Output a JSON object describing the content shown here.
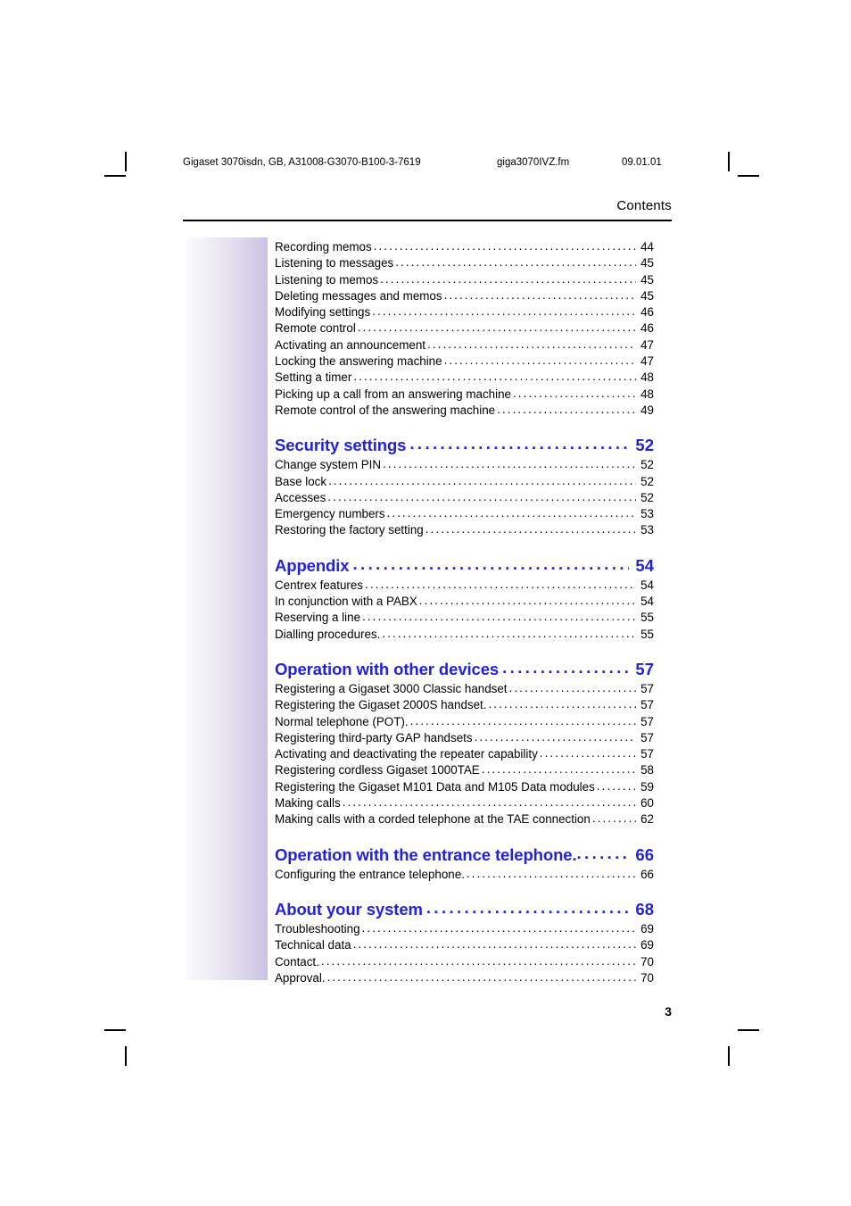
{
  "header": {
    "doc_id": "Gigaset 3070isdn, GB, A31008-G3070-B100-3-7619",
    "file_name": "giga3070IVZ.fm",
    "date": "09.01.01",
    "chapter_title": "Contents"
  },
  "folio": {
    "page_number": "3"
  },
  "toc": {
    "groups": [
      {
        "heading": null,
        "entries": [
          {
            "label": "Recording memos",
            "page": "44"
          },
          {
            "label": "Listening to messages",
            "page": "45"
          },
          {
            "label": "Listening to memos",
            "page": "45"
          },
          {
            "label": "Deleting messages and memos",
            "page": "45"
          },
          {
            "label": "Modifying settings",
            "page": "46"
          },
          {
            "label": "Remote control",
            "page": "46"
          },
          {
            "label": "Activating an announcement",
            "page": "47"
          },
          {
            "label": "Locking the answering machine",
            "page": "47"
          },
          {
            "label": "Setting a timer",
            "page": "48"
          },
          {
            "label": "Picking up a call from an answering machine",
            "page": "48"
          },
          {
            "label": "Remote control of the answering machine",
            "page": "49"
          }
        ]
      },
      {
        "heading": {
          "label": "Security settings",
          "page": "52"
        },
        "entries": [
          {
            "label": "Change system PIN",
            "page": "52"
          },
          {
            "label": "Base lock",
            "page": "52"
          },
          {
            "label": "Accesses",
            "page": "52"
          },
          {
            "label": "Emergency numbers",
            "page": "53"
          },
          {
            "label": "Restoring the factory setting",
            "page": "53"
          }
        ]
      },
      {
        "heading": {
          "label": "Appendix",
          "page": "54"
        },
        "entries": [
          {
            "label": "Centrex features",
            "page": "54"
          },
          {
            "label": "In conjunction with a PABX",
            "page": "54"
          },
          {
            "label": "Reserving a line",
            "page": "55"
          },
          {
            "label": "Dialling procedures.",
            "page": "55"
          }
        ]
      },
      {
        "heading": {
          "label": "Operation with other devices",
          "page": "57"
        },
        "entries": [
          {
            "label": "Registering a Gigaset 3000 Classic handset",
            "page": "57"
          },
          {
            "label": "Registering the Gigaset 2000S handset.",
            "page": "57"
          },
          {
            "label": "Normal telephone (POT).",
            "page": "57"
          },
          {
            "label": "Registering third-party GAP handsets",
            "page": "57"
          },
          {
            "label": "Activating and deactivating the repeater capability",
            "page": "57"
          },
          {
            "label": "Registering cordless Gigaset 1000TAE",
            "page": "58"
          },
          {
            "label": "Registering the Gigaset M101 Data and M105 Data modules",
            "page": "59"
          },
          {
            "label": "Making calls",
            "page": "60"
          },
          {
            "label": "Making calls with a corded telephone at the TAE connection",
            "page": "62"
          }
        ]
      },
      {
        "heading": {
          "label": "Operation with the entrance telephone.",
          "page": "66"
        },
        "entries": [
          {
            "label": "Configuring the entrance telephone.",
            "page": "66"
          }
        ]
      },
      {
        "heading": {
          "label": "About your system",
          "page": "68"
        },
        "entries": [
          {
            "label": "Troubleshooting",
            "page": "69"
          },
          {
            "label": "Technical data",
            "page": "69"
          },
          {
            "label": "Contact.",
            "page": "70"
          },
          {
            "label": "Approval.",
            "page": "70"
          }
        ]
      }
    ]
  },
  "decor": {
    "band_gradient_from": "#fbfafd",
    "band_gradient_to": "#cbc3e4",
    "heading_color": "#2222dd",
    "rule_color": "#000000"
  }
}
